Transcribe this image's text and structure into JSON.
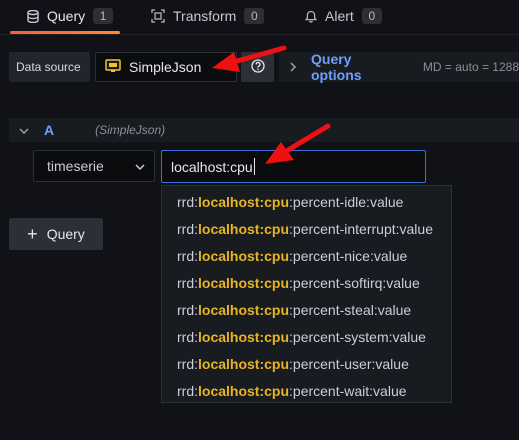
{
  "tabs": [
    {
      "label": "Query",
      "count": "1",
      "active": true,
      "icon": "database-icon"
    },
    {
      "label": "Transform",
      "count": "0",
      "active": false,
      "icon": "transform-icon"
    },
    {
      "label": "Alert",
      "count": "0",
      "active": false,
      "icon": "bell-icon"
    }
  ],
  "datasource": {
    "label": "Data source",
    "selected": "SimpleJson",
    "icon": "simplejson-icon"
  },
  "query_options": {
    "title": "Query options",
    "summary": "MD = auto = 1288"
  },
  "query": {
    "ref_id": "A",
    "datasource_name": "(SimpleJson)",
    "type_select": "timeserie",
    "target_value": "localhost:cpu"
  },
  "suggestions": [
    {
      "prefix": "rrd:",
      "match": "localhost:cpu",
      "suffix": ":percent-idle:value"
    },
    {
      "prefix": "rrd:",
      "match": "localhost:cpu",
      "suffix": ":percent-interrupt:value"
    },
    {
      "prefix": "rrd:",
      "match": "localhost:cpu",
      "suffix": ":percent-nice:value"
    },
    {
      "prefix": "rrd:",
      "match": "localhost:cpu",
      "suffix": ":percent-softirq:value"
    },
    {
      "prefix": "rrd:",
      "match": "localhost:cpu",
      "suffix": ":percent-steal:value"
    },
    {
      "prefix": "rrd:",
      "match": "localhost:cpu",
      "suffix": ":percent-system:value"
    },
    {
      "prefix": "rrd:",
      "match": "localhost:cpu",
      "suffix": ":percent-user:value"
    },
    {
      "prefix": "rrd:",
      "match": "localhost:cpu",
      "suffix": ":percent-wait:value"
    }
  ],
  "add_query_label": "Query",
  "colors": {
    "accent": "#6e9fff",
    "highlight": "#e6b523",
    "annotation_arrow": "#ee1111",
    "tab_active": "#f55f3e"
  }
}
